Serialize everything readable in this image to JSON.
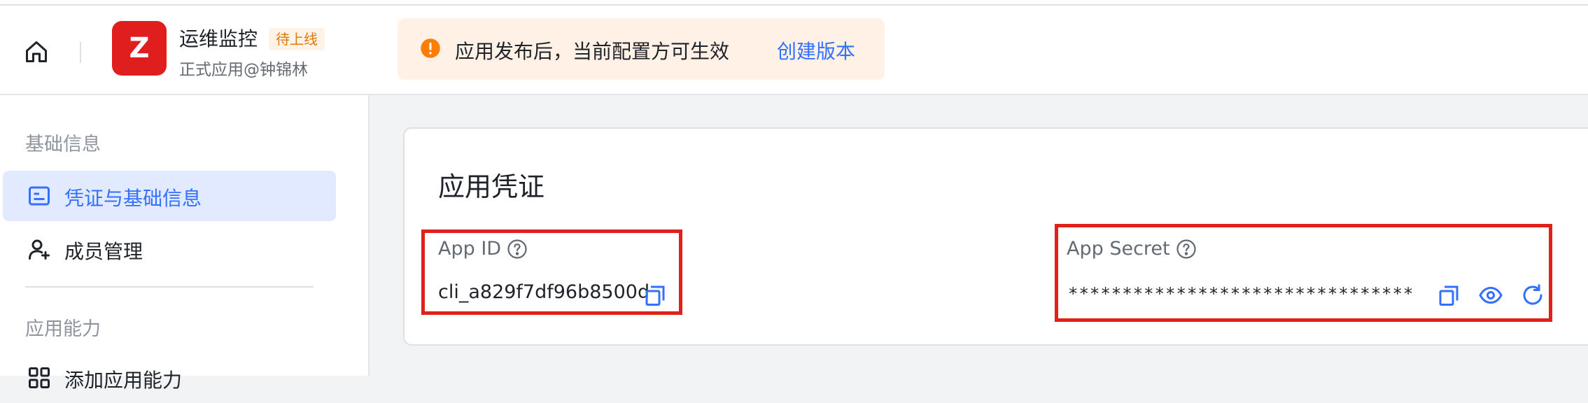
{
  "header": {
    "app_logo_letter": "Z",
    "app_name": "运维监控",
    "status_tag": "待上线",
    "app_subtitle": "正式应用@钟锦林",
    "notice_text": "应用发布后，当前配置方可生效",
    "notice_link": "创建版本"
  },
  "sidebar": {
    "group_basic": "基础信息",
    "items_basic": [
      {
        "label": "凭证与基础信息",
        "icon": "credential-icon",
        "active": true
      },
      {
        "label": "成员管理",
        "icon": "user-add-icon",
        "active": false
      }
    ],
    "group_capability": "应用能力",
    "items_capability": [
      {
        "label": "添加应用能力",
        "icon": "grid-icon",
        "active": false
      }
    ]
  },
  "credentials": {
    "title": "应用凭证",
    "app_id_label": "App ID",
    "app_id_value": "cli_a829f7df96b8500d",
    "app_secret_label": "App Secret",
    "app_secret_value": "********************************"
  },
  "colors": {
    "accent": "#3370ff",
    "highlight": "#e0201b",
    "logo": "#e01e1e",
    "notice_bg": "#fff1e6",
    "warning": "#ff7d00"
  }
}
